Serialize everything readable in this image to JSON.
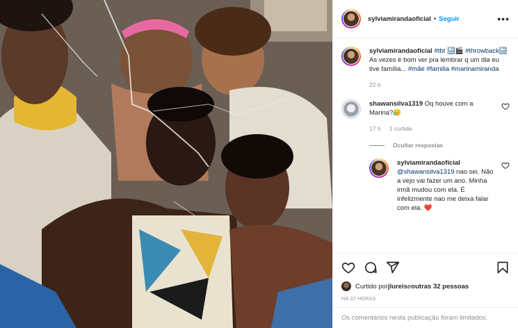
{
  "post": {
    "username": "sylviamirandaoficial",
    "follow_label": "Seguir",
    "more_label": "•••"
  },
  "caption": {
    "username": "sylviamirandaoficial",
    "text_parts": [
      "#tbt",
      " 🔙🎬 ",
      "#throwback",
      "🔙 As vezes é bom ver pra lembrar q um dia eu tive família... ",
      "#mãe",
      " ",
      "#familia",
      " ",
      "#marinamiranda"
    ],
    "time": "22 h"
  },
  "comment": {
    "username": "shawansilva1319",
    "text": "Oq houve com a Marina?",
    "emoji": "😥",
    "time": "17 h",
    "likes": "1 curtida"
  },
  "hide_replies_label": "Ocultar respostas",
  "reply": {
    "username": "sylviamirandaoficial",
    "mention": "@shawansilva1319",
    "text": " nao sei. Não a vejo vai fazer um ano. Minha irmã mudou com ela. É infelizmente nao me deixa falar com ela. ",
    "emoji": "❤️"
  },
  "likes": {
    "prefix": "Curtido por ",
    "user": "jlureis",
    "middle": " e ",
    "others": "outras 32 pessoas"
  },
  "timestamp": "HÁ 22 HORAS",
  "limited_notice": "Os comentários nesta publicação foram limitados.",
  "icons": {
    "like": "heart-icon",
    "comment": "comment-icon",
    "share": "share-icon",
    "save": "bookmark-icon"
  },
  "colors": {
    "link": "#0095f6",
    "hashtag": "#00376b",
    "muted": "#8e8e8e",
    "heart_red": "#ed4956"
  }
}
